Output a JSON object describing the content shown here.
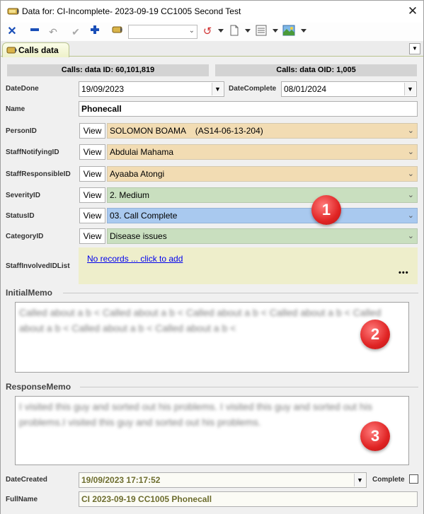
{
  "window": {
    "title": "Data for: CI-Incomplete- 2023-09-19 CC1005 Second Test",
    "close": "✕"
  },
  "toolbar": {
    "buttons": [
      "cancel-icon",
      "delete-icon",
      "undo-icon",
      "accept-icon",
      "add-icon",
      "edit-icon",
      "undo-history-icon",
      "report-icon",
      "layout-icon",
      "map-icon"
    ],
    "combo_value": ""
  },
  "tab": {
    "label": "Calls data"
  },
  "header": {
    "data_id": "Calls: data ID: 60,101,819",
    "data_oid": "Calls: data OID: 1,005"
  },
  "fields": {
    "date_done_label": "DateDone",
    "date_done_value": "19/09/2023",
    "date_complete_label": "DateComplete",
    "date_complete_value": "08/01/2024",
    "name_label": "Name",
    "name_value": "Phonecall",
    "person_label": "PersonID",
    "person_value": "SOLOMON BOAMA    (AS14-06-13-204)",
    "notifying_label": "StaffNotifyingID",
    "notifying_value": "Abdulai Mahama",
    "responsible_label": "StaffResponsibleID",
    "responsible_value": "Ayaaba Atongi",
    "severity_label": "SeverityID",
    "severity_value": "2. Medium",
    "status_label": "StatusID",
    "status_value": "03. Call Complete",
    "category_label": "CategoryID",
    "category_value": "Disease issues",
    "involved_label": "StaffInvolvedIDList",
    "involved_link": "No records ... click to add",
    "involved_more": "•••",
    "view_label": "View"
  },
  "memos": {
    "initial_title": "InitialMemo",
    "initial_text": "Called about a b < Called about a b < Called about a b < Called about a b < Called about a b < Called about a b < Called about a b <",
    "response_title": "ResponseMemo",
    "response_text": "I visited this guy and sorted out his problems. I visited this guy and sorted out his problems.I visited this guy and sorted out his problems."
  },
  "footer": {
    "date_created_label": "DateCreated",
    "date_created_value": "19/09/2023 17:17:52",
    "complete_label": "Complete",
    "fullname_label": "FullName",
    "fullname_value": "CI 2023-09-19 CC1005 Phonecall"
  },
  "annotations": [
    "1",
    "2",
    "3"
  ],
  "colors": {
    "person_bg": "#f2dcb3",
    "severity_bg": "#c9dfbf",
    "status_bg": "#a9c9ef",
    "involved_bg": "#eeeecb",
    "link": "#0000ee",
    "badge": "#e02424"
  }
}
